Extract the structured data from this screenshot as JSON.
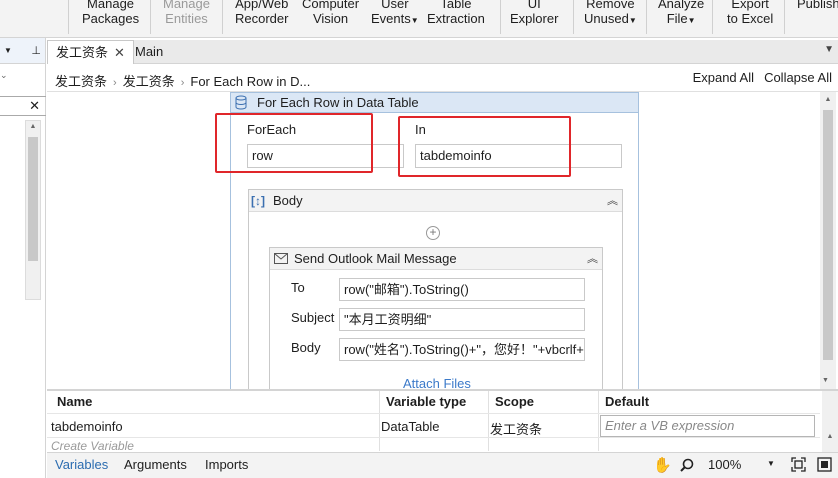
{
  "ribbon": {
    "buttons": [
      {
        "line1": "Manage",
        "line2": "Packages",
        "disabled": false
      },
      {
        "line1": "Manage",
        "line2": "Entities",
        "disabled": true
      },
      {
        "line1": "App/Web",
        "line2": "Recorder",
        "disabled": false
      },
      {
        "line1": "Computer",
        "line2": "Vision",
        "disabled": false
      },
      {
        "line1": "User",
        "line2": "Events",
        "disabled": false
      },
      {
        "line1": "Table",
        "line2": "Extraction",
        "disabled": false
      },
      {
        "line1": "UI",
        "line2": "Explorer",
        "disabled": false
      },
      {
        "line1": "Remove",
        "line2": "Unused",
        "disabled": false
      },
      {
        "line1": "Analyze",
        "line2": "File",
        "disabled": false
      },
      {
        "line1": "Export",
        "line2": "to Excel",
        "disabled": false
      },
      {
        "line1": "Publish",
        "line2": "",
        "disabled": false
      }
    ]
  },
  "tabs": [
    {
      "label": "发工资条",
      "active": true
    },
    {
      "label": "Main",
      "active": false
    }
  ],
  "breadcrumb": [
    "发工资条",
    "发工资条",
    "For Each Row in D..."
  ],
  "toolbar": {
    "expand_all": "Expand All",
    "collapse_all": "Collapse All"
  },
  "activity": {
    "title": "For Each Row in Data Table",
    "foreach_label": "ForEach",
    "foreach_value": "row",
    "in_label": "In",
    "in_value": "tabdemoinfo",
    "body_title": "Body",
    "mail": {
      "title": "Send Outlook Mail Message",
      "to_label": "To",
      "to_value": "row(\"邮箱\").ToString()",
      "subject_label": "Subject",
      "subject_value": "\"本月工资明细\"",
      "body_label": "Body",
      "body_value": "row(\"姓名\").ToString()+\"，您好！\"+vbcrlf+",
      "attach": "Attach Files"
    }
  },
  "variables": {
    "headers": [
      "Name",
      "Variable type",
      "Scope",
      "Default"
    ],
    "rows": [
      {
        "name": "tabdemoinfo",
        "type": "DataTable",
        "scope": "发工资条",
        "default_placeholder": "Enter a VB expression"
      }
    ],
    "create": "Create Variable"
  },
  "bottom": {
    "tabs": [
      "Variables",
      "Arguments",
      "Imports"
    ],
    "zoom": "100%"
  },
  "colors": {
    "highlight": "#e0262a",
    "activity_header": "#dbe7f5",
    "link": "#3c7ac9"
  }
}
